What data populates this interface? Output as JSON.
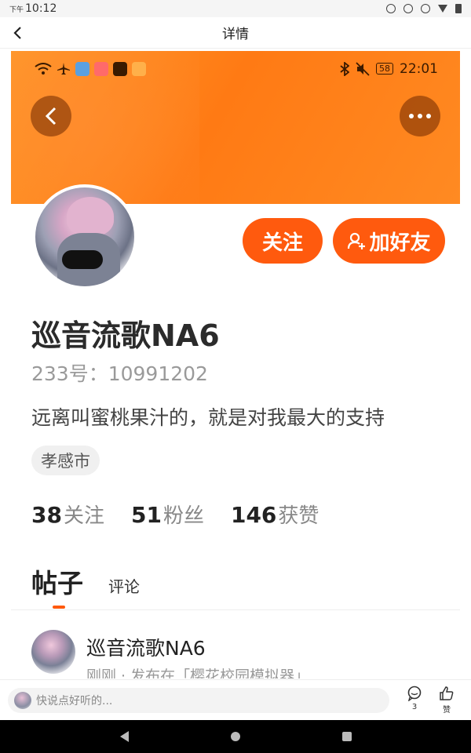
{
  "status_bar": {
    "ampm": "下午",
    "time": "10:12"
  },
  "nav": {
    "title": "详情"
  },
  "embedded_status": {
    "battery": "58",
    "time": "22:01"
  },
  "profile": {
    "name": "巡音流歌NA6",
    "uid": "233号：10991202",
    "bio": "远离叫蜜桃果汁的，就是对我最大的支持",
    "location": "孝感市",
    "follow_label": "关注",
    "add_friend_label": "加好友"
  },
  "stats": [
    {
      "num": "38",
      "label": "关注"
    },
    {
      "num": "51",
      "label": "粉丝"
    },
    {
      "num": "146",
      "label": "获赞"
    }
  ],
  "tabs": {
    "posts": "帖子",
    "comments": "评论"
  },
  "post": {
    "user": "巡音流歌NA6",
    "meta": "刚刚 · 发布在「樱花校园模拟器」"
  },
  "bottom": {
    "placeholder": "快说点好听的...",
    "comment_count": "3",
    "like_label": "赞"
  },
  "colors": {
    "accent": "#ff5a0e",
    "banner": "#ff8a22"
  }
}
